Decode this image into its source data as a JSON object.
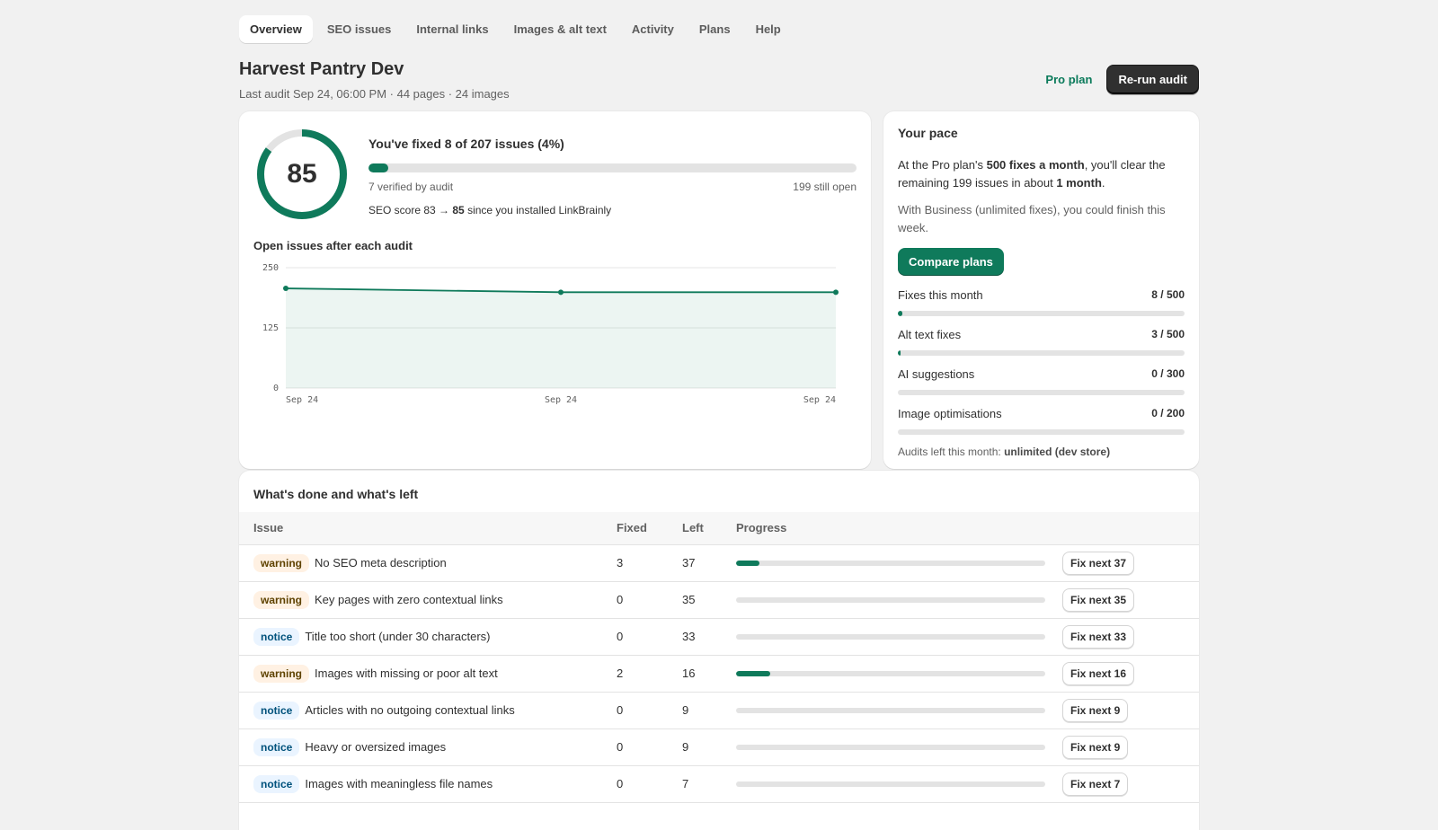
{
  "colors": {
    "accent": "#0f7a5b",
    "dark_button": "#303030",
    "warning_bg": "#fff1e3",
    "notice_bg": "#eaf4ff"
  },
  "tabs": [
    {
      "label": "Overview",
      "active": true
    },
    {
      "label": "SEO issues"
    },
    {
      "label": "Internal links"
    },
    {
      "label": "Images & alt text"
    },
    {
      "label": "Activity"
    },
    {
      "label": "Plans"
    },
    {
      "label": "Help"
    }
  ],
  "header": {
    "title": "Harvest Pantry Dev",
    "subtitle": "Last audit Sep 24, 06:00 PM · 44 pages · 24 images",
    "plan_badge": "Pro plan",
    "rerun_label": "Re-run audit"
  },
  "progress": {
    "score": "85",
    "score_fraction": 0.85,
    "fixed_title": "You've fixed 8 of 207 issues (4%)",
    "fixed_fraction": 0.04,
    "verified": "7 verified by audit",
    "still_open": "199 still open",
    "score_prefix": "SEO score 83 → ",
    "score_new": "85",
    "score_suffix": " since you installed LinkBrainly"
  },
  "chart_title": "Open issues after each audit",
  "chart_data": {
    "type": "area",
    "categories": [
      "Sep 24",
      "Sep 24",
      "Sep 24"
    ],
    "values": [
      207,
      199,
      199
    ],
    "yticks": [
      "250",
      "125",
      "0"
    ],
    "ylim": [
      0,
      250
    ],
    "grid": true,
    "color": "#0f7a5b"
  },
  "pace": {
    "title": "Your pace",
    "p1_a": "At the Pro plan's ",
    "p1_b": "500 fixes a month",
    "p1_c": ", you'll clear the remaining 199 issues in about ",
    "p1_d": "1 month",
    "p1_e": ".",
    "p2": "With Business (unlimited fixes), you could finish this week.",
    "compare_label": "Compare plans",
    "quotas": [
      {
        "label": "Fixes this month",
        "value": "8 / 500",
        "fraction": 0.016
      },
      {
        "label": "Alt text fixes",
        "value": "3 / 500",
        "fraction": 0.006
      },
      {
        "label": "AI suggestions",
        "value": "0 / 300",
        "fraction": 0
      },
      {
        "label": "Image optimisations",
        "value": "0 / 200",
        "fraction": 0
      }
    ],
    "audits_prefix": "Audits left this month: ",
    "audits_value": "unlimited (dev store)"
  },
  "table": {
    "title": "What's done and what's left",
    "headers": {
      "issue": "Issue",
      "fixed": "Fixed",
      "left": "Left",
      "progress": "Progress"
    },
    "rows": [
      {
        "severity": "warning",
        "issue": "No SEO meta description",
        "fixed": "3",
        "left": "37",
        "fraction": 0.075,
        "action": "Fix next 37"
      },
      {
        "severity": "warning",
        "issue": "Key pages with zero contextual links",
        "fixed": "0",
        "left": "35",
        "fraction": 0,
        "action": "Fix next 35"
      },
      {
        "severity": "notice",
        "issue": "Title too short (under 30 characters)",
        "fixed": "0",
        "left": "33",
        "fraction": 0,
        "action": "Fix next 33"
      },
      {
        "severity": "warning",
        "issue": "Images with missing or poor alt text",
        "fixed": "2",
        "left": "16",
        "fraction": 0.111,
        "action": "Fix next 16"
      },
      {
        "severity": "notice",
        "issue": "Articles with no outgoing contextual links",
        "fixed": "0",
        "left": "9",
        "fraction": 0,
        "action": "Fix next 9"
      },
      {
        "severity": "notice",
        "issue": "Heavy or oversized images",
        "fixed": "0",
        "left": "9",
        "fraction": 0,
        "action": "Fix next 9"
      },
      {
        "severity": "notice",
        "issue": "Images with meaningless file names",
        "fixed": "0",
        "left": "7",
        "fraction": 0,
        "action": "Fix next 7"
      }
    ]
  }
}
